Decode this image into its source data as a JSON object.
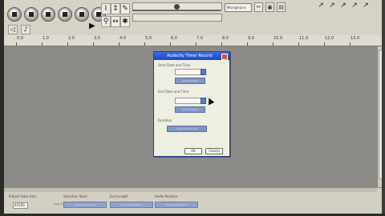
{
  "toolbar": {
    "device_text": "Microphone",
    "play_at_icon": "play-icon"
  },
  "ruler": {
    "ticks": [
      "0.0",
      "1.0",
      "2.0",
      "3.0",
      "4.0",
      "5.0",
      "6.0",
      "7.0",
      "8.0",
      "9.0",
      "10.0",
      "11.0",
      "12.0",
      "13.0"
    ]
  },
  "dialog": {
    "title": "Audacity Timer Record",
    "start_group": "Start Date and Time",
    "end_group": "End Date and Time",
    "duration_group": "Duration",
    "start_time": "0 0 0 0 0 0 0",
    "end_time": "0 0 0 0 0 0 0",
    "duration": "0 0 0 0 0 0 0 0 0",
    "ok_label": "OK",
    "cancel_label": "Cancel"
  },
  "selection_bar": {
    "project_rate_label": "Project Rate (Hz):",
    "project_rate_value": "44100",
    "selection_start_label": "Selection Start:",
    "end_length_label": "End  Length",
    "audio_position_label": "Audio Position:",
    "snap_label": "Snap To",
    "start_value": "0 0 h 0 0 m 0 0 s",
    "end_value": "0 0 h 0 0 m 0 0 s",
    "position_value": "0 0 h 0 0 m 0 0 s"
  }
}
